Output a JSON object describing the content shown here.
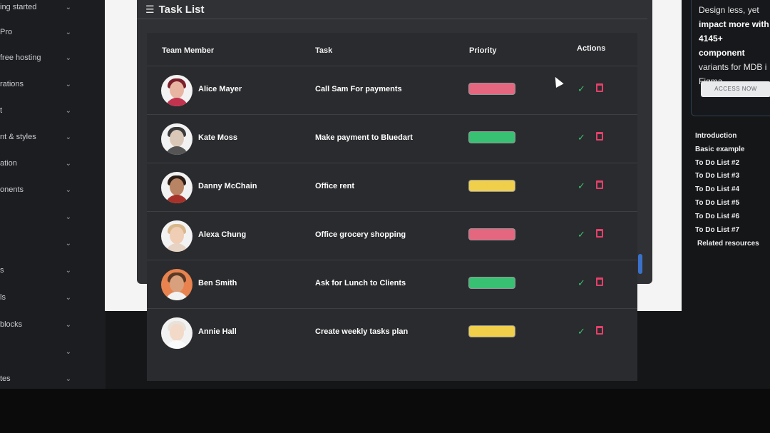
{
  "sidebar": {
    "items": [
      {
        "label": "ing started"
      },
      {
        "label": "Pro"
      },
      {
        "label": "free hosting"
      },
      {
        "label": "rations"
      },
      {
        "label": "t"
      },
      {
        "label": "nt & styles"
      },
      {
        "label": "ation"
      },
      {
        "label": "onents"
      },
      {
        "label": ""
      },
      {
        "label": ""
      },
      {
        "label": "s"
      },
      {
        "label": "ls"
      },
      {
        "label": "blocks"
      },
      {
        "label": ""
      },
      {
        "label": "tes"
      }
    ]
  },
  "card": {
    "title": "Task List"
  },
  "table": {
    "headers": {
      "member": "Team Member",
      "task": "Task",
      "priority": "Priority",
      "actions": "Actions"
    },
    "rows": [
      {
        "name": "Alice Mayer",
        "task": "Call Sam For payments",
        "priority": "High priority",
        "level": "high"
      },
      {
        "name": "Kate Moss",
        "task": "Make payment to Bluedart",
        "priority": "Low priority",
        "level": "low"
      },
      {
        "name": "Danny McChain",
        "task": "Office rent",
        "priority": "Middle priority",
        "level": "mid"
      },
      {
        "name": "Alexa Chung",
        "task": "Office grocery shopping",
        "priority": "High priority",
        "level": "high"
      },
      {
        "name": "Ben Smith",
        "task": "Ask for Lunch to Clients",
        "priority": "Low priority",
        "level": "low"
      },
      {
        "name": "Annie Hall",
        "task": "Create weekly tasks plan",
        "priority": "Middle priority",
        "level": "mid"
      }
    ],
    "check_symbol": "✓"
  },
  "colors": {
    "high": "#e5667f",
    "low": "#38c172",
    "mid": "#f0cf4a",
    "accent": "#3b71ca"
  },
  "promo": {
    "line1": "Design less, yet",
    "line2": "impact more with",
    "line3": "4145+ component",
    "line4": "variants for MDB i",
    "line5": "Figma.",
    "button": "ACCESS NOW"
  },
  "toc": [
    "Introduction",
    "Basic example",
    "To Do List #2",
    "To Do List #3",
    "To Do List #4",
    "To Do List #5",
    "To Do List #6",
    "To Do List #7",
    "Related resources"
  ]
}
